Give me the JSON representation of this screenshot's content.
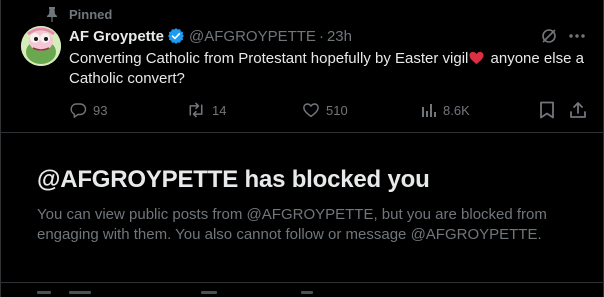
{
  "pinned": {
    "label": "Pinned",
    "icon": "pin-icon"
  },
  "tweet": {
    "display_name": "AF Groypette",
    "verified_icon": "verified-badge-icon",
    "handle": "@AFGROYPETTE",
    "separator": "·",
    "time": "23h",
    "text_before": "Converting Catholic from Protestant hopefully by Easter vigil",
    "emoji": "red-heart-emoji",
    "text_after": " anyone else a Catholic convert?",
    "actions": {
      "replies": "93",
      "reposts": "14",
      "likes": "510",
      "views": "8.6K"
    }
  },
  "blocked": {
    "title": "@AFGROYPETTE has blocked you",
    "description": "You can view public posts from @AFGROYPETTE, but you are blocked from engaging with them. You also cannot follow or message @AFGROYPETTE."
  },
  "colors": {
    "background": "#000000",
    "text_primary": "#e7e9ea",
    "text_secondary": "#71767b",
    "border": "#2f3336",
    "verified": "#1d9bf0",
    "heart": "#dd2e44"
  }
}
